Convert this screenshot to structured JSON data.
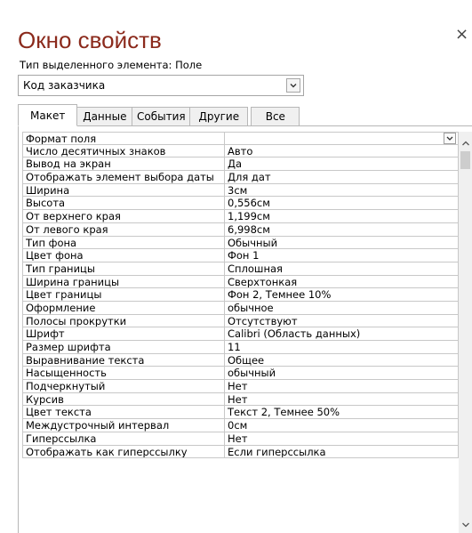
{
  "window": {
    "title": "Окно свойств",
    "close_glyph": "×",
    "selection_type_label": "Тип выделенного элемента:  Поле"
  },
  "selector": {
    "value": "Код заказчика"
  },
  "tabs": [
    {
      "label": "Макет",
      "active": true
    },
    {
      "label": "Данные",
      "active": false
    },
    {
      "label": "События",
      "active": false
    },
    {
      "label": "Другие",
      "active": false
    },
    {
      "label": "Все",
      "active": false
    }
  ],
  "properties": [
    {
      "name": "Формат поля",
      "value": ""
    },
    {
      "name": "Число десятичных знаков",
      "value": "Авто"
    },
    {
      "name": "Вывод на экран",
      "value": "Да"
    },
    {
      "name": "Отображать элемент выбора даты",
      "value": "Для дат"
    },
    {
      "name": "Ширина",
      "value": "3см"
    },
    {
      "name": "Высота",
      "value": "0,556см"
    },
    {
      "name": "От верхнего края",
      "value": "1,199см"
    },
    {
      "name": "От левого края",
      "value": "6,998см"
    },
    {
      "name": "Тип фона",
      "value": "Обычный"
    },
    {
      "name": "Цвет фона",
      "value": "Фон 1"
    },
    {
      "name": "Тип границы",
      "value": "Сплошная"
    },
    {
      "name": "Ширина границы",
      "value": "Сверхтонкая"
    },
    {
      "name": "Цвет границы",
      "value": "Фон 2, Темнее 10%"
    },
    {
      "name": "Оформление",
      "value": "обычное"
    },
    {
      "name": "Полосы прокрутки",
      "value": "Отсутствуют"
    },
    {
      "name": "Шрифт",
      "value": "Calibri (Область данных)"
    },
    {
      "name": "Размер шрифта",
      "value": "11"
    },
    {
      "name": "Выравнивание текста",
      "value": "Общее"
    },
    {
      "name": "Насыщенность",
      "value": "обычный"
    },
    {
      "name": "Подчеркнутый",
      "value": "Нет"
    },
    {
      "name": "Курсив",
      "value": "Нет"
    },
    {
      "name": "Цвет текста",
      "value": "Текст 2, Темнее 50%"
    },
    {
      "name": "Междустрочный интервал",
      "value": "0см"
    },
    {
      "name": "Гиперссылка",
      "value": "Нет"
    },
    {
      "name": "Отображать как гиперссылку",
      "value": "Если гиперссылка"
    }
  ],
  "colors": {
    "title": "#8b2a1c",
    "border": "#b7b7b7"
  },
  "icons": {
    "close": "close-icon",
    "dropdown": "chevron-down-icon",
    "scroll_up": "chevron-up-icon",
    "scroll_down": "chevron-down-icon"
  }
}
